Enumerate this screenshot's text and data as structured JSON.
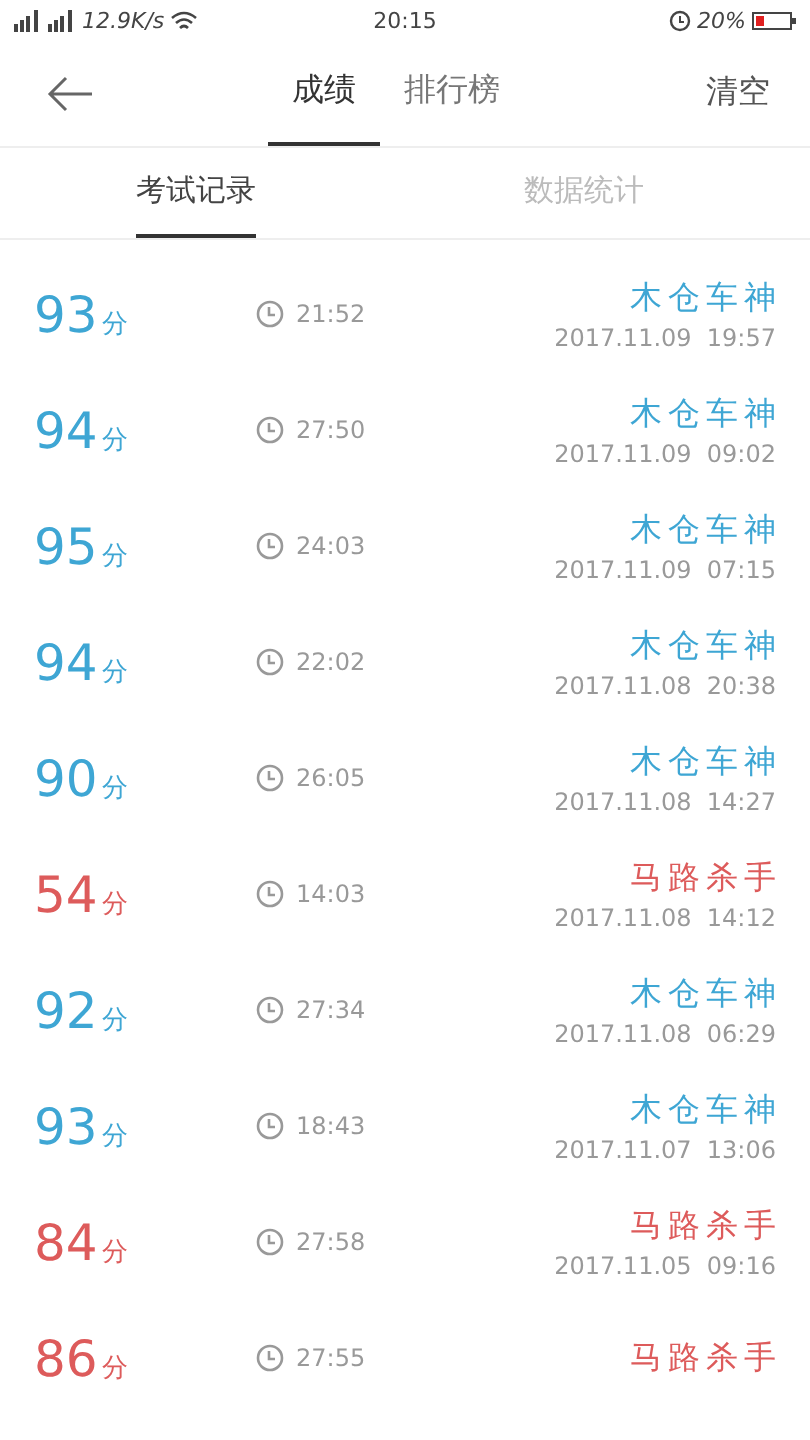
{
  "status_bar": {
    "speed": "12.9K/s",
    "time": "20:15",
    "battery": "20%"
  },
  "nav": {
    "tabs": [
      {
        "label": "成绩",
        "selected": true
      },
      {
        "label": "排行榜",
        "selected": false
      }
    ],
    "action": "清空"
  },
  "sub_tabs": [
    {
      "label": "考试记录",
      "selected": true
    },
    {
      "label": "数据统计",
      "selected": false
    }
  ],
  "records": [
    {
      "score": "93",
      "unit": "分",
      "duration": "21:52",
      "title": "木仓车神",
      "date": "2017.11.09  19:57",
      "color": "#3ea6d4"
    },
    {
      "score": "94",
      "unit": "分",
      "duration": "27:50",
      "title": "木仓车神",
      "date": "2017.11.09  09:02",
      "color": "#3ea6d4"
    },
    {
      "score": "95",
      "unit": "分",
      "duration": "24:03",
      "title": "木仓车神",
      "date": "2017.11.09  07:15",
      "color": "#3ea6d4"
    },
    {
      "score": "94",
      "unit": "分",
      "duration": "22:02",
      "title": "木仓车神",
      "date": "2017.11.08  20:38",
      "color": "#3ea6d4"
    },
    {
      "score": "90",
      "unit": "分",
      "duration": "26:05",
      "title": "木仓车神",
      "date": "2017.11.08  14:27",
      "color": "#3ea6d4"
    },
    {
      "score": "54",
      "unit": "分",
      "duration": "14:03",
      "title": "马路杀手",
      "date": "2017.11.08  14:12",
      "color": "#dd5b5b"
    },
    {
      "score": "92",
      "unit": "分",
      "duration": "27:34",
      "title": "木仓车神",
      "date": "2017.11.08  06:29",
      "color": "#3ea6d4"
    },
    {
      "score": "93",
      "unit": "分",
      "duration": "18:43",
      "title": "木仓车神",
      "date": "2017.11.07  13:06",
      "color": "#3ea6d4"
    },
    {
      "score": "84",
      "unit": "分",
      "duration": "27:58",
      "title": "马路杀手",
      "date": "2017.11.05  09:16",
      "color": "#dd5b5b"
    },
    {
      "score": "86",
      "unit": "分",
      "duration": "27:55",
      "title": "马路杀手",
      "color": "#dd5b5b"
    }
  ]
}
